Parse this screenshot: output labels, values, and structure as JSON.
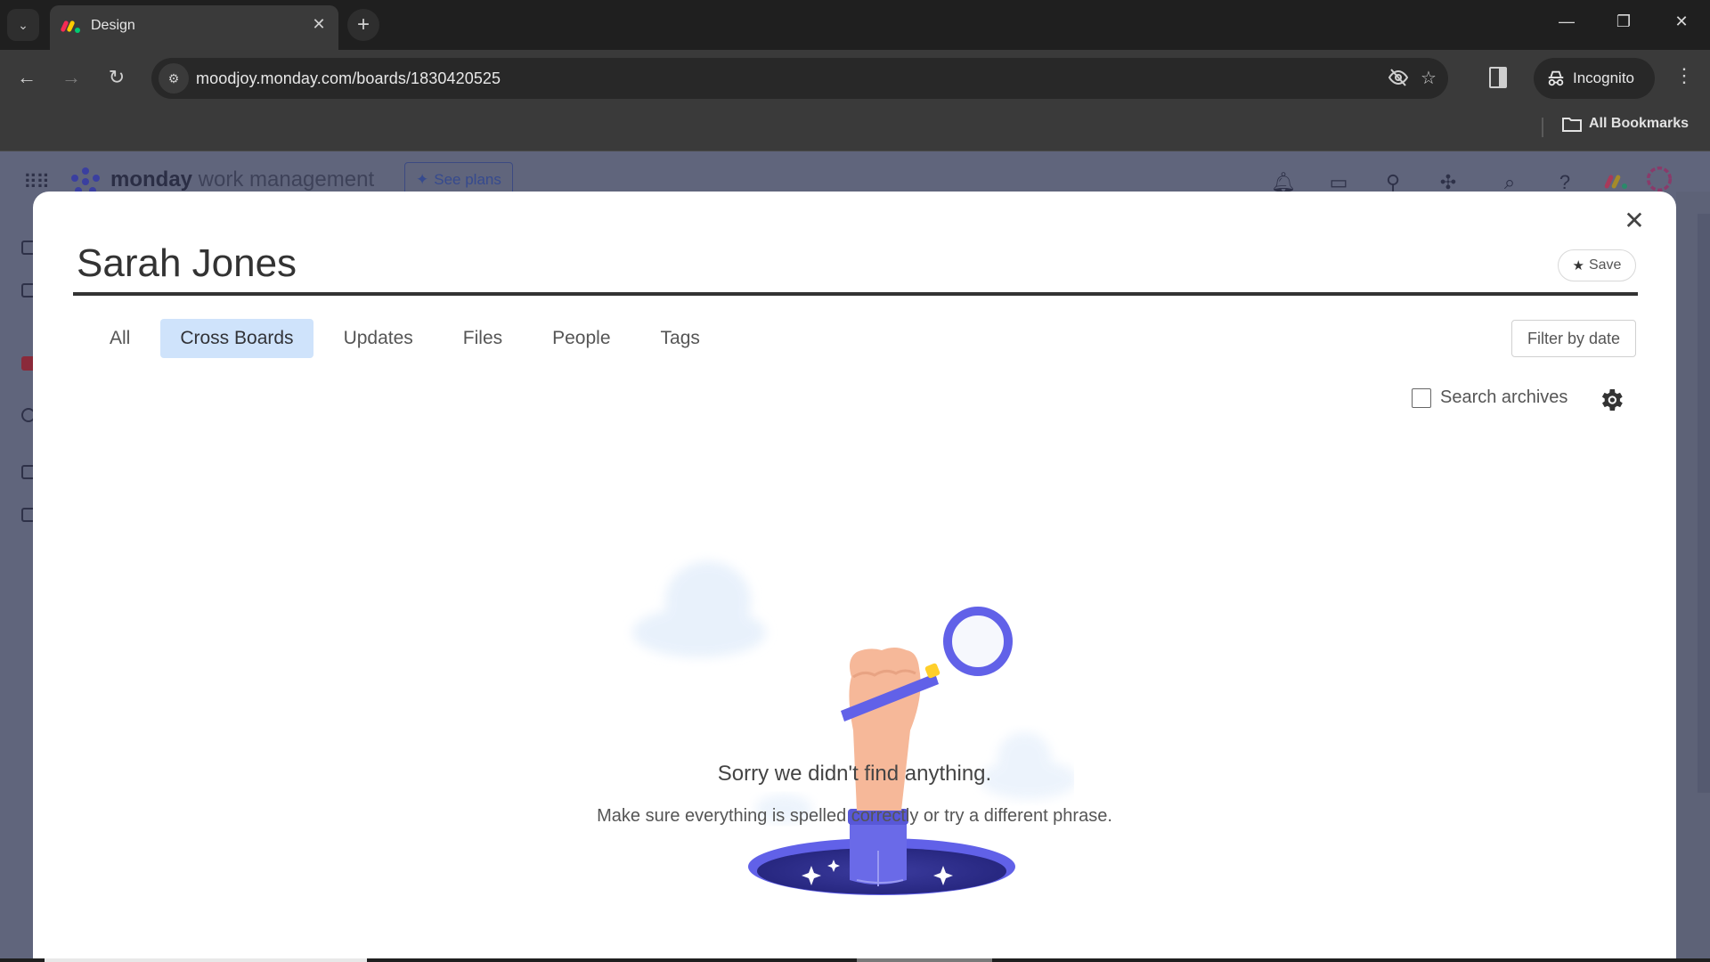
{
  "browser": {
    "tab_title": "Design",
    "tab_close": "✕",
    "new_tab": "+",
    "url": "moodjoy.monday.com/boards/1830420525",
    "incognito_label": "Incognito",
    "bookmarks_label": "All Bookmarks",
    "window_controls": {
      "minimize": "—",
      "restore": "❐",
      "close": "✕"
    },
    "nav": {
      "back": "←",
      "forward": "→",
      "reload": "↻"
    }
  },
  "app_header": {
    "brand_name": "monday",
    "brand_sub": " work management",
    "see_plans_label": "See plans",
    "icons": [
      "bell-icon",
      "inbox-icon",
      "invite-members-icon",
      "apps-icon",
      "search-icon",
      "help-icon",
      "monday-logo-icon",
      "account-avatar"
    ]
  },
  "modal": {
    "close_label": "✕",
    "search_query": "Sarah Jones",
    "save_label": "Save",
    "tabs": [
      {
        "label": "All",
        "active": false
      },
      {
        "label": "Cross Boards",
        "active": true
      },
      {
        "label": "Updates",
        "active": false
      },
      {
        "label": "Files",
        "active": false
      },
      {
        "label": "People",
        "active": false
      },
      {
        "label": "Tags",
        "active": false
      }
    ],
    "filter_by_date_label": "Filter by date",
    "search_archives_label": "Search archives",
    "search_archives_checked": false,
    "empty_title": "Sorry we didn't find anything.",
    "empty_subtitle": "Make sure everything is spelled correctly or try a different phrase."
  },
  "colors": {
    "active_tab_bg": "#cfe3fb",
    "illustration_primary": "#6161e8",
    "illustration_skin": "#f6b899",
    "overlay": "#60657c"
  }
}
